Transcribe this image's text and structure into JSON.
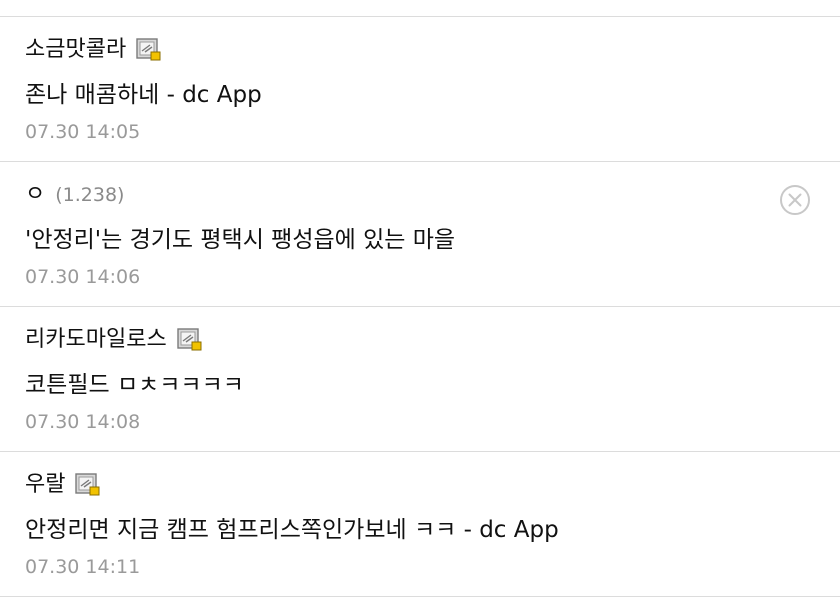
{
  "comments": [
    {
      "author": "소금맛콜라",
      "ip": "",
      "has_gallog_icon": true,
      "text": "존나 매콤하네 - dc App",
      "time": "07.30 14:05"
    },
    {
      "author": "ㅇ",
      "ip": "(1.238)",
      "has_gallog_icon": false,
      "has_delete": true,
      "text": "'안정리'는 경기도 평택시 팽성읍에 있는 마을",
      "time": "07.30 14:06"
    },
    {
      "author": "리카도마일로스",
      "ip": "",
      "has_gallog_icon": true,
      "text": "코튼필드 ㅁㅊㅋㅋㅋㅋ",
      "time": "07.30 14:08"
    },
    {
      "author": "우랄",
      "ip": "",
      "has_gallog_icon": true,
      "text": "안정리면 지금 캠프 험프리스쪽인가보네 ㅋㅋ - dc App",
      "time": "07.30 14:11"
    }
  ],
  "colors": {
    "divider": "#dcdcdc",
    "timestamp": "#9a9a9a",
    "ip": "#8a8a8a",
    "icon_accent": "#f2c200"
  },
  "icons": {
    "gallog": "gallog-icon",
    "delete": "delete-circle-x-icon"
  }
}
